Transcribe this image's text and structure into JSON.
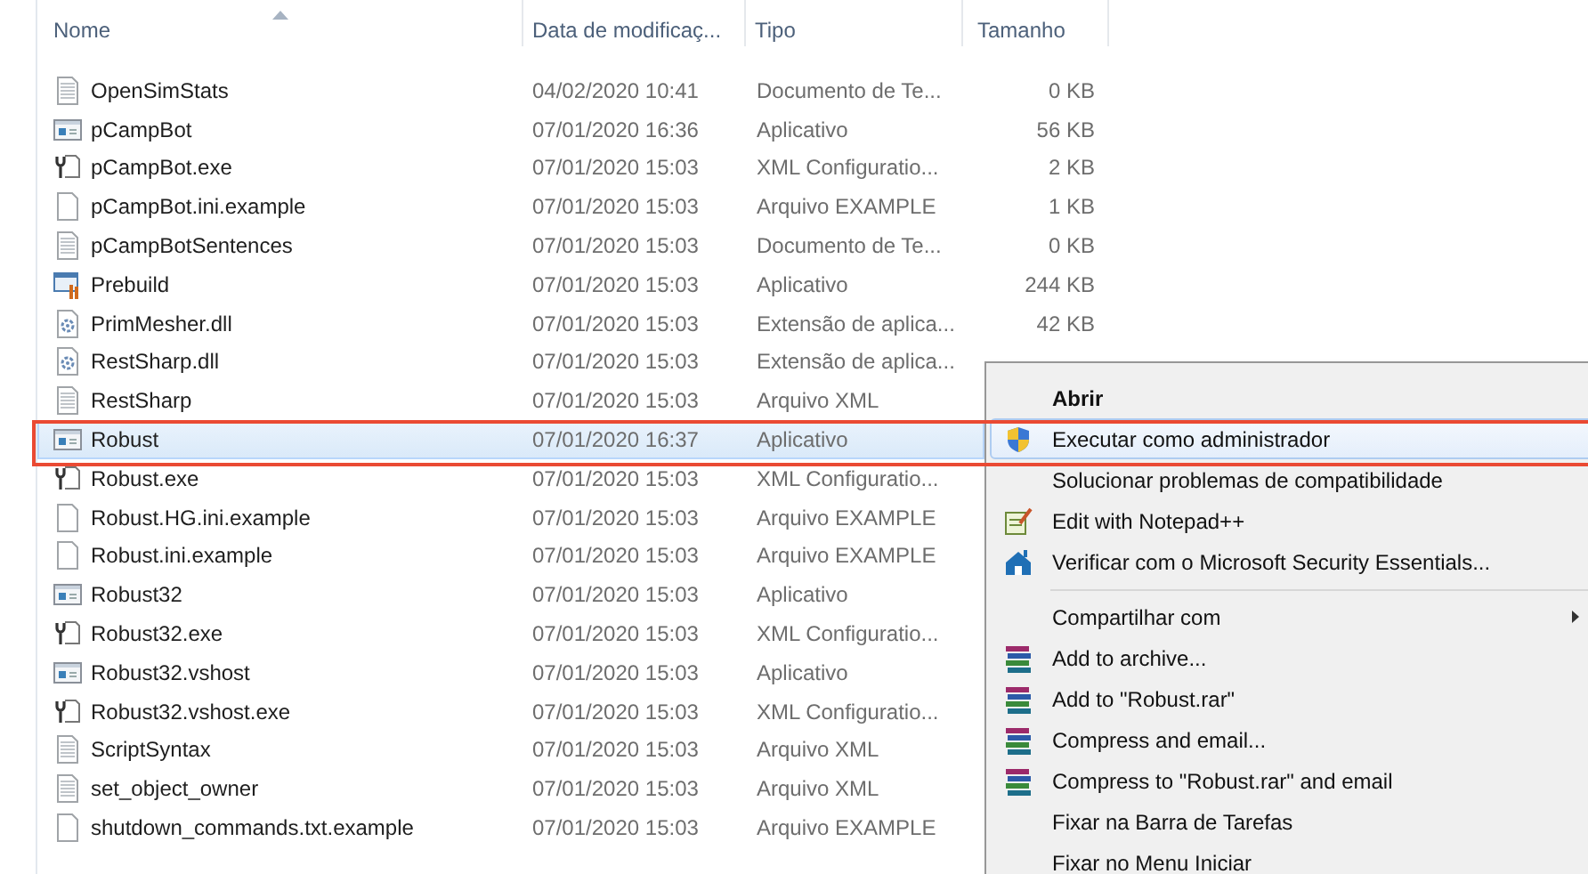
{
  "columns": [
    {
      "label": "Nome",
      "sorted": true
    },
    {
      "label": "Data de modificaç...",
      "sorted": false
    },
    {
      "label": "Tipo",
      "sorted": false
    },
    {
      "label": "Tamanho",
      "sorted": false
    }
  ],
  "files": [
    {
      "name": "OpenSimStats",
      "date": "04/02/2020 10:41",
      "type": "Documento de Te...",
      "size": "0 KB",
      "kind": "text",
      "selected": false
    },
    {
      "name": "pCampBot",
      "date": "07/01/2020 16:36",
      "type": "Aplicativo",
      "size": "56 KB",
      "kind": "app",
      "selected": false
    },
    {
      "name": "pCampBot.exe",
      "date": "07/01/2020 15:03",
      "type": "XML Configuratio...",
      "size": "2 KB",
      "kind": "config",
      "selected": false
    },
    {
      "name": "pCampBot.ini.example",
      "date": "07/01/2020 15:03",
      "type": "Arquivo EXAMPLE",
      "size": "1 KB",
      "kind": "blank",
      "selected": false
    },
    {
      "name": "pCampBotSentences",
      "date": "07/01/2020 15:03",
      "type": "Documento de Te...",
      "size": "0 KB",
      "kind": "text",
      "selected": false
    },
    {
      "name": "Prebuild",
      "date": "07/01/2020 15:03",
      "type": "Aplicativo",
      "size": "244 KB",
      "kind": "installer",
      "selected": false
    },
    {
      "name": "PrimMesher.dll",
      "date": "07/01/2020 15:03",
      "type": "Extensão de aplica...",
      "size": "42 KB",
      "kind": "dll",
      "selected": false
    },
    {
      "name": "RestSharp.dll",
      "date": "07/01/2020 15:03",
      "type": "Extensão de aplica...",
      "kind": "dll",
      "selected": false
    },
    {
      "name": "RestSharp",
      "date": "07/01/2020 15:03",
      "type": "Arquivo XML",
      "kind": "text",
      "selected": false
    },
    {
      "name": "Robust",
      "date": "07/01/2020 16:37",
      "type": "Aplicativo",
      "kind": "app",
      "selected": true
    },
    {
      "name": "Robust.exe",
      "date": "07/01/2020 15:03",
      "type": "XML Configuratio...",
      "kind": "config",
      "selected": false
    },
    {
      "name": "Robust.HG.ini.example",
      "date": "07/01/2020 15:03",
      "type": "Arquivo EXAMPLE",
      "kind": "blank",
      "selected": false
    },
    {
      "name": "Robust.ini.example",
      "date": "07/01/2020 15:03",
      "type": "Arquivo EXAMPLE",
      "kind": "blank",
      "selected": false
    },
    {
      "name": "Robust32",
      "date": "07/01/2020 15:03",
      "type": "Aplicativo",
      "kind": "app",
      "selected": false
    },
    {
      "name": "Robust32.exe",
      "date": "07/01/2020 15:03",
      "type": "XML Configuratio...",
      "kind": "config",
      "selected": false
    },
    {
      "name": "Robust32.vshost",
      "date": "07/01/2020 15:03",
      "type": "Aplicativo",
      "kind": "app",
      "selected": false
    },
    {
      "name": "Robust32.vshost.exe",
      "date": "07/01/2020 15:03",
      "type": "XML Configuratio...",
      "kind": "config",
      "selected": false
    },
    {
      "name": "ScriptSyntax",
      "date": "07/01/2020 15:03",
      "type": "Arquivo XML",
      "kind": "text",
      "selected": false
    },
    {
      "name": "set_object_owner",
      "date": "07/01/2020 15:03",
      "type": "Arquivo XML",
      "kind": "text",
      "selected": false
    },
    {
      "name": "shutdown_commands.txt.example",
      "date": "07/01/2020 15:03",
      "type": "Arquivo EXAMPLE",
      "kind": "blank",
      "selected": false
    }
  ],
  "context_menu": {
    "items": [
      {
        "label": "Abrir",
        "kind": "plain",
        "default": true,
        "selected": false
      },
      {
        "label": "Executar como administrador",
        "kind": "shield",
        "default": false,
        "selected": true
      },
      {
        "label": "Solucionar problemas de compatibilidade",
        "kind": "plain",
        "default": false,
        "selected": false
      },
      {
        "label": "Edit with Notepad++",
        "kind": "notepad",
        "default": false,
        "selected": false
      },
      {
        "label": "Verificar com o Microsoft Security Essentials...",
        "kind": "house",
        "default": false,
        "selected": false
      },
      {
        "kind": "separator"
      },
      {
        "label": "Compartilhar com",
        "kind": "plain",
        "default": false,
        "selected": false,
        "submenu": true
      },
      {
        "label": "Add to archive...",
        "kind": "books",
        "default": false,
        "selected": false
      },
      {
        "label": "Add to \"Robust.rar\"",
        "kind": "books",
        "default": false,
        "selected": false
      },
      {
        "label": "Compress and email...",
        "kind": "books",
        "default": false,
        "selected": false
      },
      {
        "label": "Compress to \"Robust.rar\" and email",
        "kind": "books",
        "default": false,
        "selected": false
      },
      {
        "label": "Fixar na Barra de Tarefas",
        "kind": "plain",
        "default": false,
        "selected": false
      },
      {
        "label": "Fixar no Menu Iniciar",
        "kind": "plain",
        "default": false,
        "selected": false
      }
    ]
  }
}
